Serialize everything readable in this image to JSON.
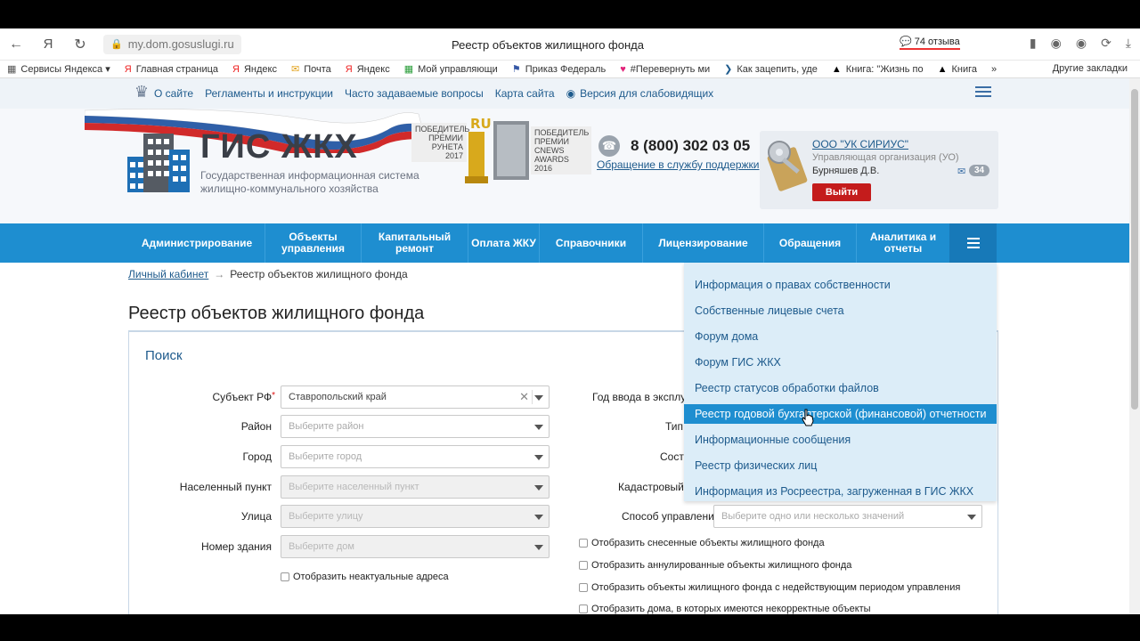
{
  "browser": {
    "url": "my.dom.gosuslugi.ru",
    "tab_title": "Реестр объектов жилищного фонда",
    "reviews": "74 отзыва",
    "bookmarks": [
      {
        "icon": "yandex-services-icon",
        "label": "Сервисы Яндекса ▾"
      },
      {
        "icon": "yandex-icon",
        "label": "Главная страница"
      },
      {
        "icon": "yandex-icon",
        "label": "Яндекс"
      },
      {
        "icon": "mail-icon",
        "label": "Почта"
      },
      {
        "icon": "yandex-icon",
        "label": "Яндекс"
      },
      {
        "icon": "grid-icon",
        "label": "Мой управляющи"
      },
      {
        "icon": "flag-icon",
        "label": "Приказ Федераль"
      },
      {
        "icon": "heart-icon",
        "label": "#Перевернуть ми"
      },
      {
        "icon": "chevron-icon",
        "label": "Как зацепить, уде"
      },
      {
        "icon": "book-icon",
        "label": "Книга: \"Жизнь по"
      },
      {
        "icon": "book-icon",
        "label": "Книга"
      }
    ],
    "more_bookmarks": "»",
    "other_bookmarks": "Другие закладки"
  },
  "site": {
    "top_links": [
      "О сайте",
      "Регламенты и инструкции",
      "Часто задаваемые вопросы",
      "Карта сайта"
    ],
    "accessibility_link": "Версия для слабовидящих",
    "logo_title": "ГИС ЖКХ",
    "logo_subtitle": "Государственная информационная система жилищно-коммунального хозяйства",
    "award_runet": "ПОБЕДИТЕЛЬ ПРЕМИИ РУНЕТА 2017",
    "award_ru": "RU",
    "award_cnews": "ПОБЕДИТЕЛЬ ПРЕМИИ CNEWS AWARDS 2016",
    "phone": "8 (800) 302 03 05",
    "support_link": "Обращение в службу поддержки",
    "org_name": "ООО \"УК СИРИУС\"",
    "org_type": "Управляющая организация (УО)",
    "user_name": "Бурняшев Д.В.",
    "logout": "Выйти",
    "mail_count": "34"
  },
  "nav": [
    "Администрирование",
    "Объекты управления",
    "Капитальный ремонт",
    "Оплата ЖКУ",
    "Справочники",
    "Лицензирование",
    "Обращения",
    "Аналитика и отчеты"
  ],
  "breadcrumb": {
    "link": "Личный кабинет",
    "arrow": "→",
    "current": "Реестр объектов жилищного фонда"
  },
  "page_title": "Реестр объектов жилищного фонда",
  "search": {
    "title": "Поиск",
    "left_fields": [
      {
        "label": "Субъект РФ",
        "required": "*",
        "value": "Ставропольский край"
      },
      {
        "label": "Район",
        "value": "Выберите район"
      },
      {
        "label": "Город",
        "value": "Выберите город"
      },
      {
        "label": "Населенный пункт",
        "value": "Выберите населенный пункт"
      },
      {
        "label": "Улица",
        "value": "Выберите улицу"
      },
      {
        "label": "Номер здания",
        "value": "Выберите дом"
      }
    ],
    "show_outdated": "Отобразить неактуальные адреса",
    "right_labels": [
      "Год ввода в эксплуата",
      "Тип",
      "Состо",
      "Кадастровый н"
    ],
    "management_label": "Способ управления",
    "management_placeholder": "Выберите одно или несколько значений",
    "checkboxes": [
      "Отобразить снесенные объекты жилищного фонда",
      "Отобразить аннулированные объекты жилищного фонда",
      "Отобразить объекты жилищного фонда с недействующим периодом управления",
      "Отобразить дома, в которых имеются некорректные объекты"
    ]
  },
  "dropdown_menu": [
    "Информация о правах собственности",
    "Собственные лицевые счета",
    "Форум дома",
    "Форум ГИС ЖКХ",
    "Реестр статусов обработки файлов",
    "Реестр годовой бухгалтерской (финансовой) отчетности",
    "Информационные сообщения",
    "Реестр физических лиц",
    "Информация из Росреестра, загруженная в ГИС ЖКХ"
  ],
  "dropdown_active_index": 5,
  "colors": {
    "nav_blue": "#1e8ed0",
    "link_blue": "#1d5a8c",
    "logout_red": "#c41c1c",
    "dropdown_bg": "#dcedf8"
  }
}
